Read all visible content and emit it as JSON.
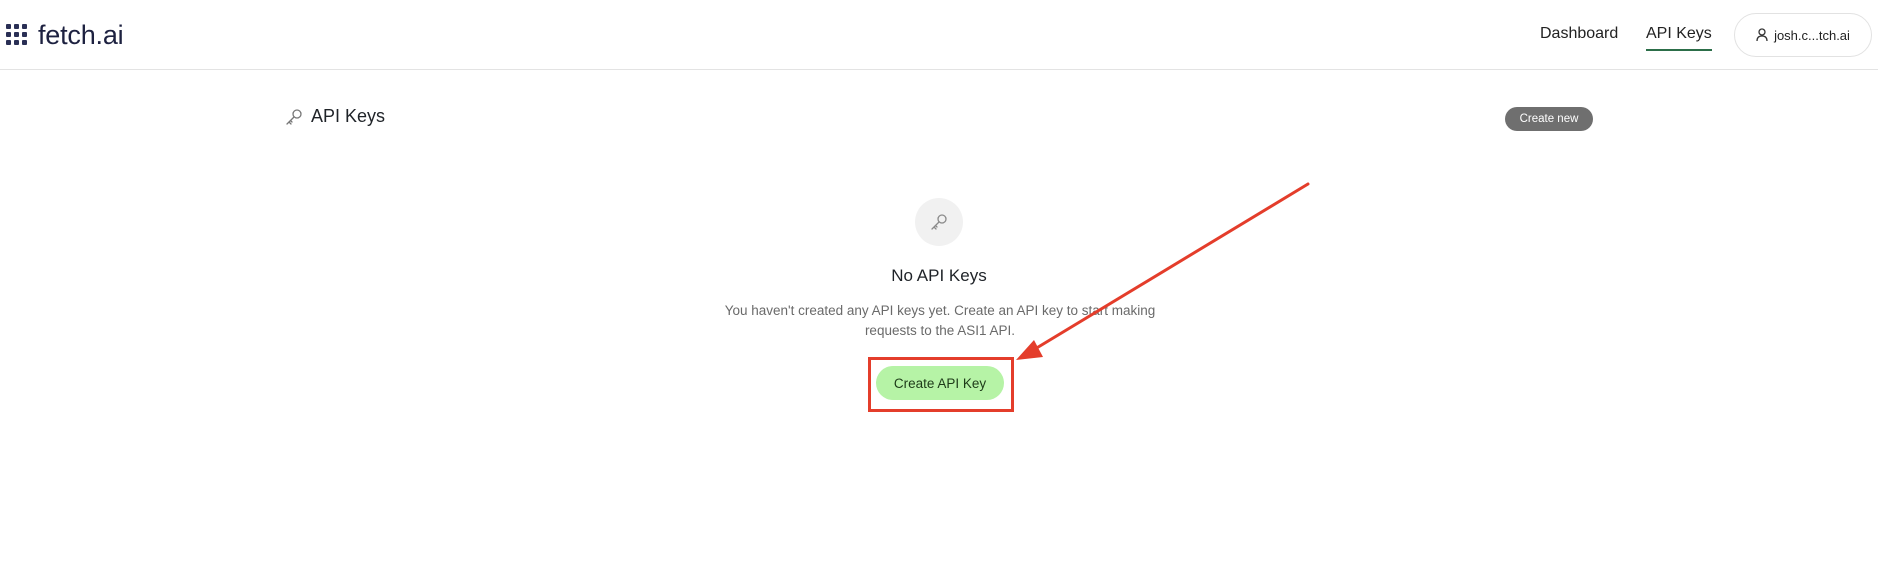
{
  "brand": {
    "name": "fetch.ai",
    "icon": "grid-dots-icon"
  },
  "nav": {
    "dashboard": "Dashboard",
    "api_keys": "API Keys",
    "account": "josh.c...tch.ai"
  },
  "page": {
    "title": "API Keys",
    "create_new": "Create new"
  },
  "empty_state": {
    "title": "No API Keys",
    "description": "You haven't created any API keys yet. Create an API key to start making requests to the ASI1 API.",
    "button": "Create API Key"
  },
  "colors": {
    "accent_green": "#b6f3a6",
    "annotation_red": "#e43d2b",
    "create_new_bg": "#6f6f6f",
    "nav_underline": "#2c6e49"
  }
}
